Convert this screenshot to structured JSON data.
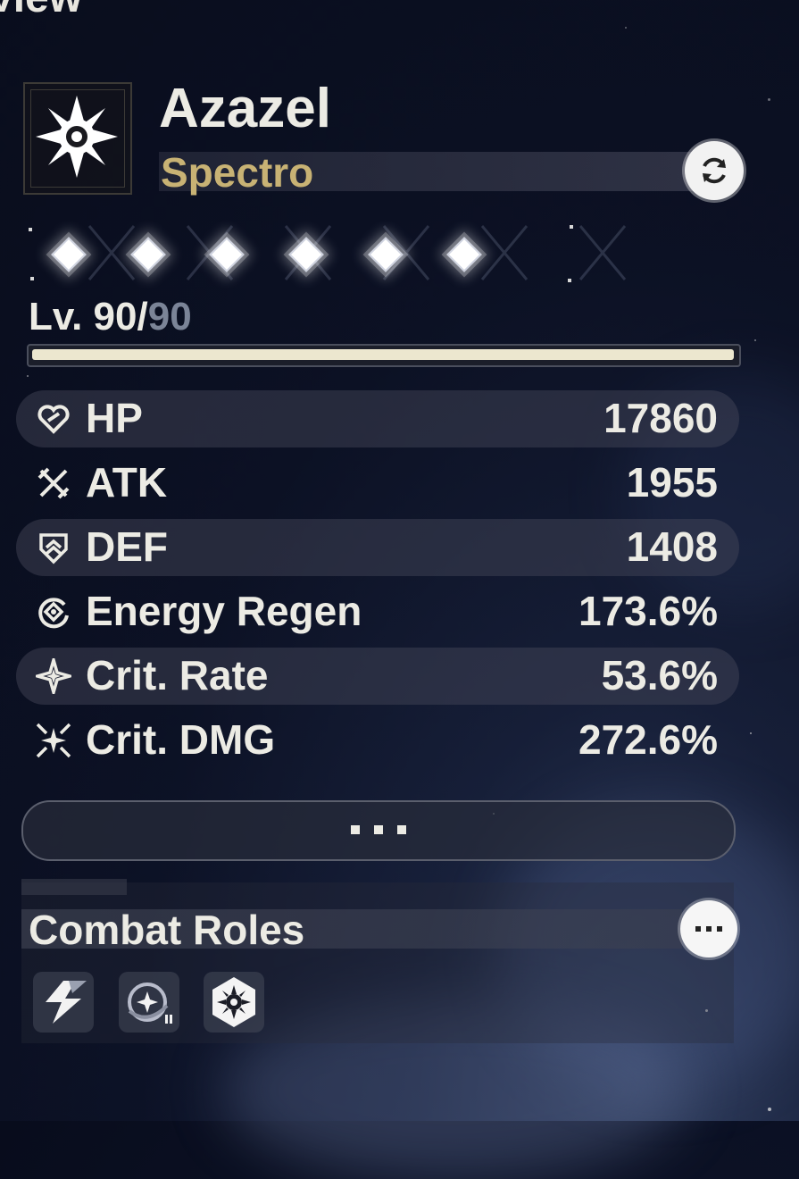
{
  "header": {
    "partial_title": "view"
  },
  "character": {
    "name": "Azazel",
    "element": "Spectro",
    "element_icon": "spectro-icon",
    "swap_icon": "refresh-icon"
  },
  "sequence": {
    "unlocked_nodes": 6,
    "total_nodes": 6
  },
  "level": {
    "prefix": "Lv. ",
    "current": "90",
    "separator": "/",
    "max": "90",
    "progress_fraction": 1.0
  },
  "stats": [
    {
      "icon": "hp-icon",
      "label": "HP",
      "value": "17860"
    },
    {
      "icon": "atk-icon",
      "label": "ATK",
      "value": "1955"
    },
    {
      "icon": "def-icon",
      "label": "DEF",
      "value": "1408"
    },
    {
      "icon": "energy-regen-icon",
      "label": "Energy Regen",
      "value": "173.6%"
    },
    {
      "icon": "crit-rate-icon",
      "label": "Crit. Rate",
      "value": "53.6%"
    },
    {
      "icon": "crit-dmg-icon",
      "label": "Crit. DMG",
      "value": "272.6%"
    }
  ],
  "combat_roles": {
    "title": "Combat Roles",
    "roles": [
      {
        "icon": "lightning-slash-icon"
      },
      {
        "icon": "star-orbit-icon"
      },
      {
        "icon": "spectro-hex-icon"
      }
    ]
  },
  "colors": {
    "element": "#c8b274",
    "text": "#ecebe4",
    "max_level": "#7b8497",
    "xp_fill": "#ece7cf"
  }
}
